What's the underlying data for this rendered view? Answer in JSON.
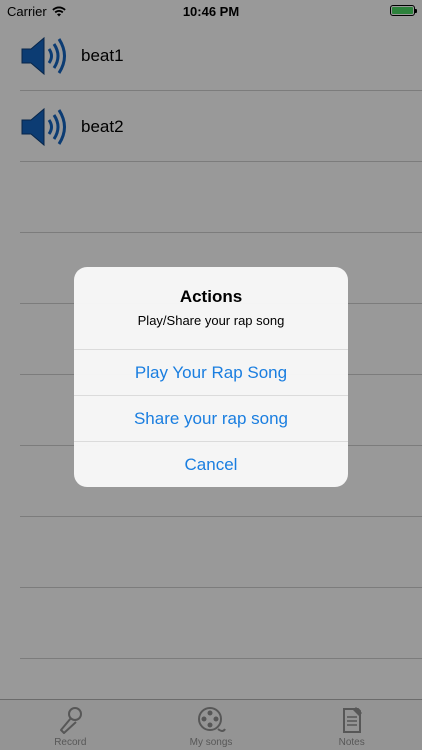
{
  "status_bar": {
    "carrier": "Carrier",
    "time": "10:46 PM",
    "battery_color": "#4cd964"
  },
  "songs": [
    {
      "title": "beat1",
      "icon": "speaker-icon"
    },
    {
      "title": "beat2",
      "icon": "speaker-icon"
    }
  ],
  "tab_bar": {
    "tabs": [
      {
        "label": "Record",
        "icon": "microphone-icon"
      },
      {
        "label": "My songs",
        "icon": "film-reel-icon"
      },
      {
        "label": "Notes",
        "icon": "notepad-icon"
      }
    ]
  },
  "alert": {
    "title": "Actions",
    "message": "Play/Share your rap song",
    "actions": [
      {
        "label": "Play Your Rap Song"
      },
      {
        "label": "Share your rap song"
      },
      {
        "label": "Cancel"
      }
    ]
  },
  "colors": {
    "accent": "#1a7ee0",
    "speaker_blue": "#1565c0"
  }
}
